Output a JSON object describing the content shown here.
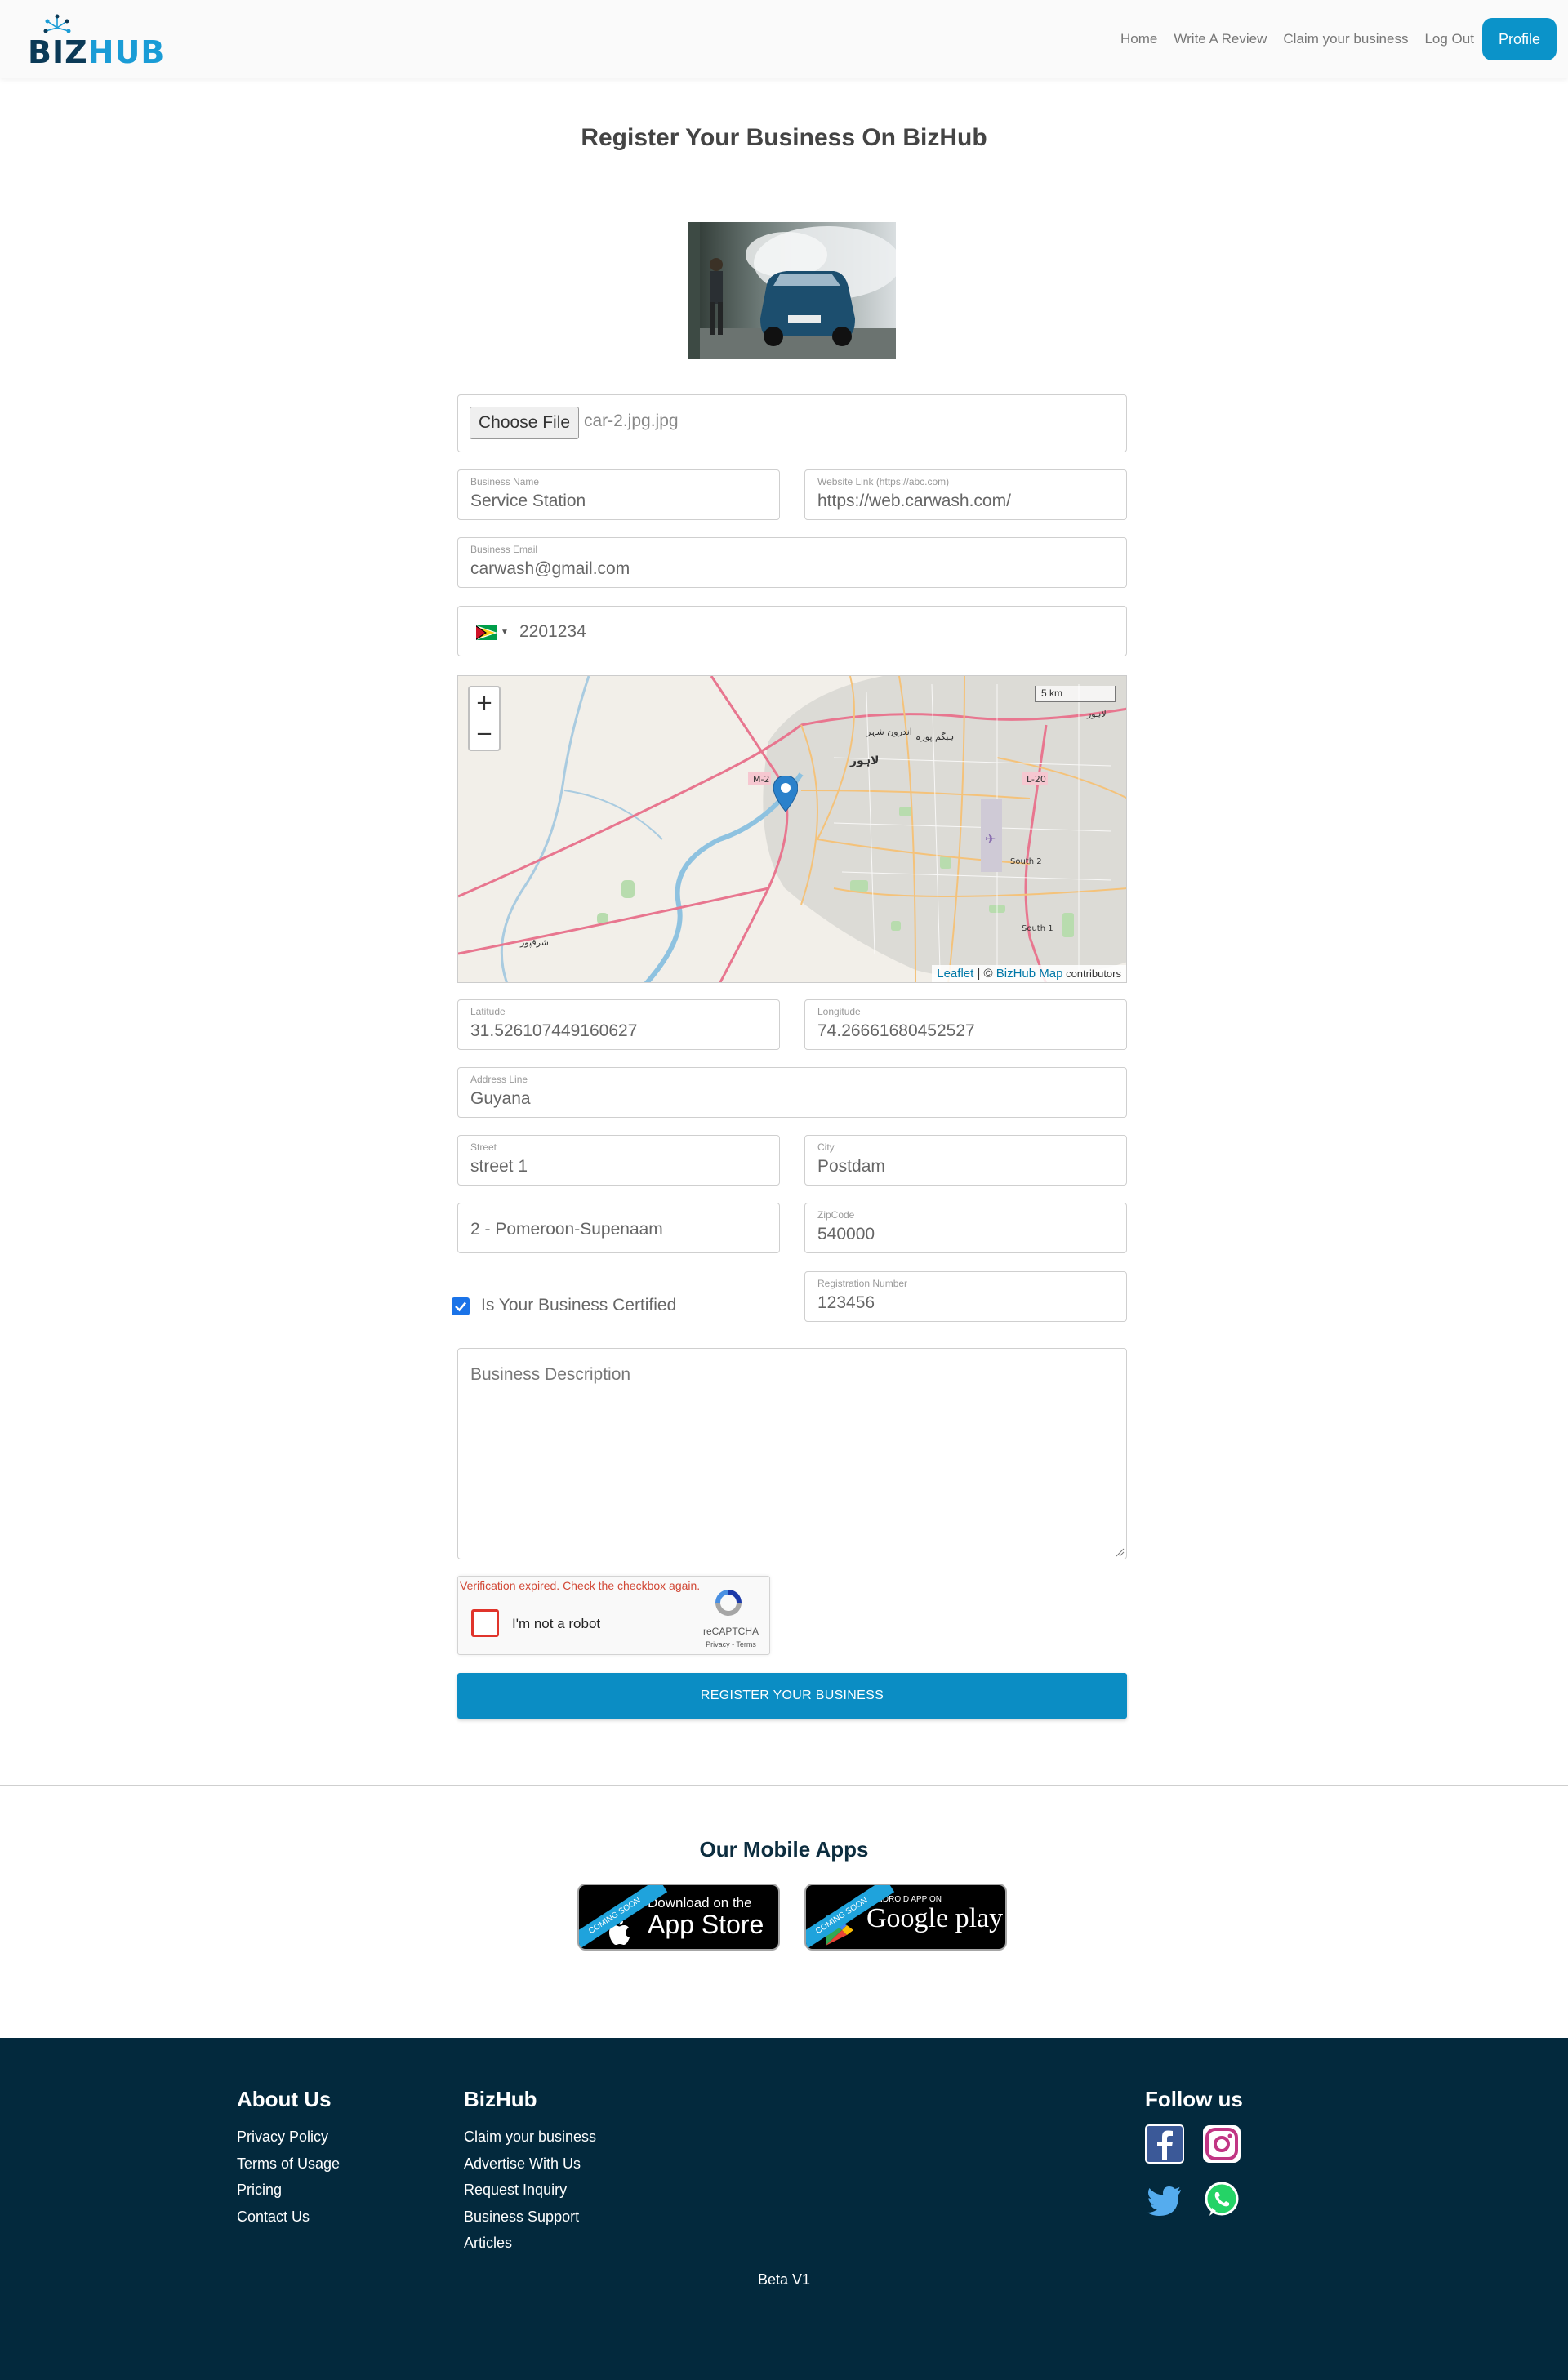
{
  "header": {
    "logo": "BIZHUB",
    "nav": [
      "Home",
      "Write A Review",
      "Claim your business",
      "Log Out"
    ],
    "profile_label": "Profile"
  },
  "page": {
    "title": "Register Your Business On BizHub"
  },
  "form": {
    "file": {
      "button": "Choose File",
      "filename": "car-2.jpg.jpg"
    },
    "business_name": {
      "label": "Business Name",
      "value": "Service Station"
    },
    "website": {
      "label": "Website Link (https://abc.com)",
      "value": "https://web.carwash.com/"
    },
    "email": {
      "label": "Business Email",
      "value": "carwash@gmail.com"
    },
    "phone": {
      "value": "2201234",
      "country_flag": "guyana-flag-icon"
    },
    "map": {
      "zoom_in": "+",
      "zoom_out": "−",
      "scale": "5 km",
      "attribution_leaflet": "Leaflet",
      "attribution_sep": " | © ",
      "attribution_bizhub": "BizHub Map",
      "attribution_contrib": " contributors",
      "labels": [
        "M-2",
        "L-20",
        "South 2",
        "South 1",
        "لاہور",
        "لاہور",
        "اندرون شہر",
        "ہیگم پورہ",
        "شرقپور"
      ]
    },
    "latitude": {
      "label": "Latitude",
      "value": "31.526107449160627"
    },
    "longitude": {
      "label": "Longitude",
      "value": "74.26661680452527"
    },
    "address": {
      "label": "Address Line",
      "value": "Guyana"
    },
    "street": {
      "label": "Street",
      "value": "street 1"
    },
    "city": {
      "label": "City",
      "value": "Postdam"
    },
    "region": {
      "value": "2 - Pomeroon-Supenaam"
    },
    "zipcode": {
      "label": "ZipCode",
      "value": "540000"
    },
    "certified": {
      "label": "Is Your Business Certified",
      "checked": true
    },
    "registration": {
      "label": "Registration Number",
      "value": "123456"
    },
    "description": {
      "placeholder": "Business Description"
    },
    "captcha": {
      "error": "Verification expired. Check the checkbox again.",
      "label": "I'm not a robot",
      "brand": "reCAPTCHA",
      "links": "Privacy - Terms"
    },
    "submit_label": "REGISTER YOUR BUSINESS"
  },
  "apps": {
    "title": "Our Mobile Apps",
    "appstore": {
      "ribbon": "COMING SOON",
      "line1": "Download on the",
      "line2": "App Store"
    },
    "googleplay": {
      "ribbon": "COMING SOON",
      "line1": "ANDROID APP ON",
      "line2": "Google play"
    }
  },
  "footer": {
    "about": {
      "title": "About Us",
      "links": [
        "Privacy Policy",
        "Terms of Usage",
        "Pricing",
        "Contact Us"
      ]
    },
    "bizhub": {
      "title": "BizHub",
      "links": [
        "Claim your business",
        "Advertise With Us",
        "Request Inquiry",
        "Business Support",
        "Articles"
      ]
    },
    "follow": {
      "title": "Follow us"
    },
    "version": "Beta V1"
  },
  "colors": {
    "primary": "#0b8dc4",
    "footer_bg": "#03293d",
    "checkbox": "#1a73e8",
    "error": "#d14836"
  }
}
